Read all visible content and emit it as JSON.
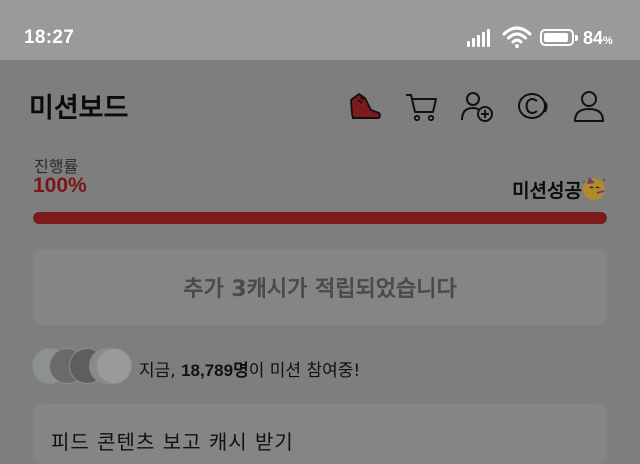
{
  "status_bar": {
    "time": "18:27",
    "battery_level": "84",
    "battery_unit": "%",
    "icons": [
      "signal-icon",
      "wifi-icon",
      "battery-icon"
    ]
  },
  "header": {
    "title": "미션보드",
    "icons": [
      "sneaker-icon",
      "cart-icon",
      "add-friend-icon",
      "coin-icon",
      "profile-icon"
    ]
  },
  "progress": {
    "label": "진행률",
    "value_text": "100%",
    "fraction": 1.0,
    "status_text": "미션성공",
    "status_icon": "party-face-icon",
    "accent_color": "#7d1a1c"
  },
  "banner": {
    "text": "추가 3캐시가 적립되었습니다"
  },
  "participants": {
    "prefix": "지금, ",
    "count": "18,789명",
    "suffix": "이 미션 참여중!"
  },
  "feed_card": {
    "title": "피드 콘텐츠 보고 캐시 받기"
  }
}
